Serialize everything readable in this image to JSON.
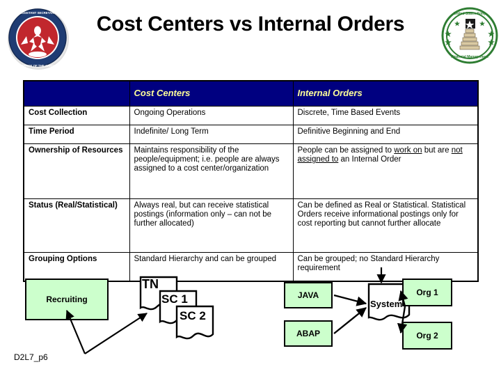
{
  "slide": {
    "title": "Cost Centers vs Internal Orders",
    "footer_code": "D2L7_p6"
  },
  "logos": {
    "left": {
      "name": "office-of-the-assistant-secretary-of-the-army-seal",
      "ring_color": "#1F3C73",
      "emblem_color": "#C1272D"
    },
    "right": {
      "name": "united-states-army-seal",
      "ring_color": "#2E7D32",
      "emblem_color": "#D9C9A3"
    }
  },
  "table": {
    "header": {
      "blank": "",
      "cost_centers": "Cost Centers",
      "internal_orders": "Internal Orders",
      "bg_color": "#000080",
      "text_color": "#FFFF99"
    },
    "rows": [
      {
        "label": "Cost Collection",
        "cost_centers": "Ongoing Operations",
        "internal_orders": "Discrete, Time Based Events"
      },
      {
        "label": "Time Period",
        "cost_centers": "Indefinite/ Long Term",
        "internal_orders": "Definitive Beginning and End"
      },
      {
        "label": "Ownership of Resources",
        "cost_centers": "Maintains responsibility of the people/equipment; i.e. people are always assigned to a cost center/organization",
        "internal_orders_parts": {
          "before": "People can be assigned to ",
          "underline_1": "work on",
          "middle": " but are ",
          "underline_2": "not assigned to",
          "after": " an Internal Order"
        }
      },
      {
        "label": "Status (Real/Statistical)",
        "cost_centers": "Always real, but can receive statistical postings (information only – can not be further allocated)",
        "internal_orders": "Can be defined as Real or Statistical. Statistical Orders receive informational postings only for cost reporting but cannot further allocate"
      },
      {
        "label": "Grouping Options",
        "cost_centers": "Standard Hierarchy and can be grouped",
        "internal_orders": "Can be grouped; no Standard Hierarchy requirement"
      }
    ]
  },
  "diagram": {
    "box_fill": "#CCFFCC",
    "left_group": {
      "recruiting": "Recruiting",
      "documents": [
        "TN",
        "SC 1",
        "SC 2"
      ]
    },
    "right_group": {
      "inputs": [
        "JAVA",
        "ABAP"
      ],
      "system": "System",
      "outputs": [
        "Org 1",
        "Org 2"
      ]
    }
  }
}
